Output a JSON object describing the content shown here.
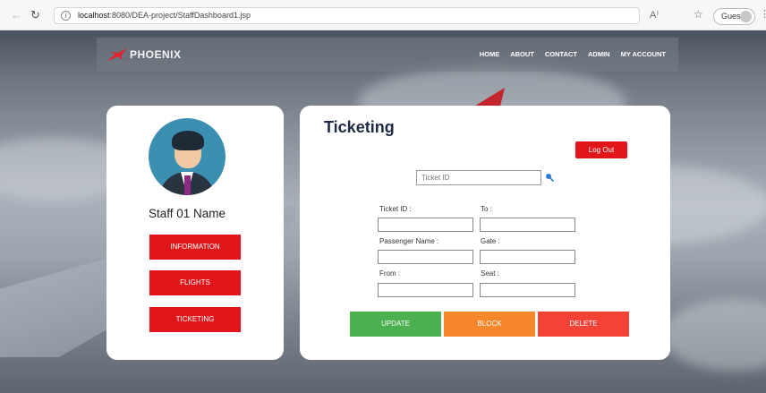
{
  "browser": {
    "url_host": "localhost",
    "url_rest": ":8080/DEA-project/StaffDashboard1.jsp",
    "reader_label": "A⁾",
    "guest_label": "Guest"
  },
  "nav": {
    "logo_text": "PHOENIX",
    "links": [
      "HOME",
      "ABOUT",
      "CONTACT",
      "ADMIN",
      "MY ACCOUNT"
    ]
  },
  "profile": {
    "name": "Staff 01 Name",
    "buttons": [
      "INFORMATION",
      "FLIGHTS",
      "TICKETING"
    ]
  },
  "ticketing": {
    "title": "Ticketing",
    "logout_label": "Log Out",
    "search_placeholder": "Ticket ID",
    "labels": {
      "ticket_id": "Ticket ID :",
      "to": "To :",
      "passenger_name": "Passenger Name :",
      "gate": "Gate :",
      "from": "From :",
      "seat": "Seat :"
    },
    "values": {
      "ticket_id": "",
      "to": "",
      "passenger_name": "",
      "gate": "",
      "from": "",
      "seat": ""
    },
    "actions": [
      "UPDATE",
      "BLOCK",
      "DELETE"
    ]
  },
  "colors": {
    "primary_red": "#e0161b",
    "update_green": "#4caf50",
    "block_orange": "#f7872b",
    "delete_red": "#f44336",
    "title_navy": "#1f2a44"
  }
}
